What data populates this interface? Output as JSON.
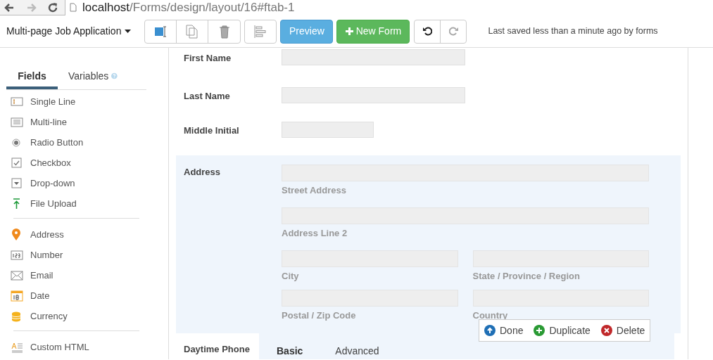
{
  "browser": {
    "url_host": "localhost",
    "url_path": "/Forms/design/layout/16#ftab-1"
  },
  "toolbar": {
    "form_title": "Multi-page Job Application",
    "preview": "Preview",
    "new_form": "New Form",
    "status": "Last saved less than a minute ago by forms"
  },
  "sidebar": {
    "tabs": [
      {
        "label": "Fields",
        "selected": true
      },
      {
        "label": "Variables",
        "selected": false
      }
    ],
    "groups": [
      [
        {
          "label": "Single Line",
          "kind": "single-line"
        },
        {
          "label": "Multi-line",
          "kind": "multi-line"
        },
        {
          "label": "Radio Button",
          "kind": "radio"
        },
        {
          "label": "Checkbox",
          "kind": "checkbox"
        },
        {
          "label": "Drop-down",
          "kind": "dropdown"
        },
        {
          "label": "File Upload",
          "kind": "upload"
        }
      ],
      [
        {
          "label": "Address",
          "kind": "address"
        },
        {
          "label": "Number",
          "kind": "number"
        },
        {
          "label": "Email",
          "kind": "email"
        },
        {
          "label": "Date",
          "kind": "date"
        },
        {
          "label": "Currency",
          "kind": "currency"
        }
      ],
      [
        {
          "label": "Custom HTML",
          "kind": "html"
        }
      ]
    ]
  },
  "form": {
    "fields": [
      {
        "label": "First Name",
        "kind": "text"
      },
      {
        "label": "Last Name",
        "kind": "text"
      },
      {
        "label": "Middle Initial",
        "kind": "initial"
      }
    ],
    "address": {
      "label": "Address",
      "rows": [
        [
          {
            "caption": "Street Address"
          }
        ],
        [
          {
            "caption": "Address Line 2"
          }
        ],
        [
          {
            "caption": "City"
          },
          {
            "caption": "State / Province / Region"
          }
        ],
        [
          {
            "caption": "Postal / Zip Code"
          },
          {
            "caption": "Country"
          }
        ]
      ],
      "actions": [
        {
          "label": "Done",
          "kind": "done"
        },
        {
          "label": "Duplicate",
          "kind": "duplicate"
        },
        {
          "label": "Delete",
          "kind": "delete"
        }
      ]
    },
    "phone": {
      "label": "Daytime Phone",
      "tabs": [
        {
          "label": "Basic",
          "selected": true
        },
        {
          "label": "Advanced",
          "selected": false
        }
      ]
    }
  }
}
